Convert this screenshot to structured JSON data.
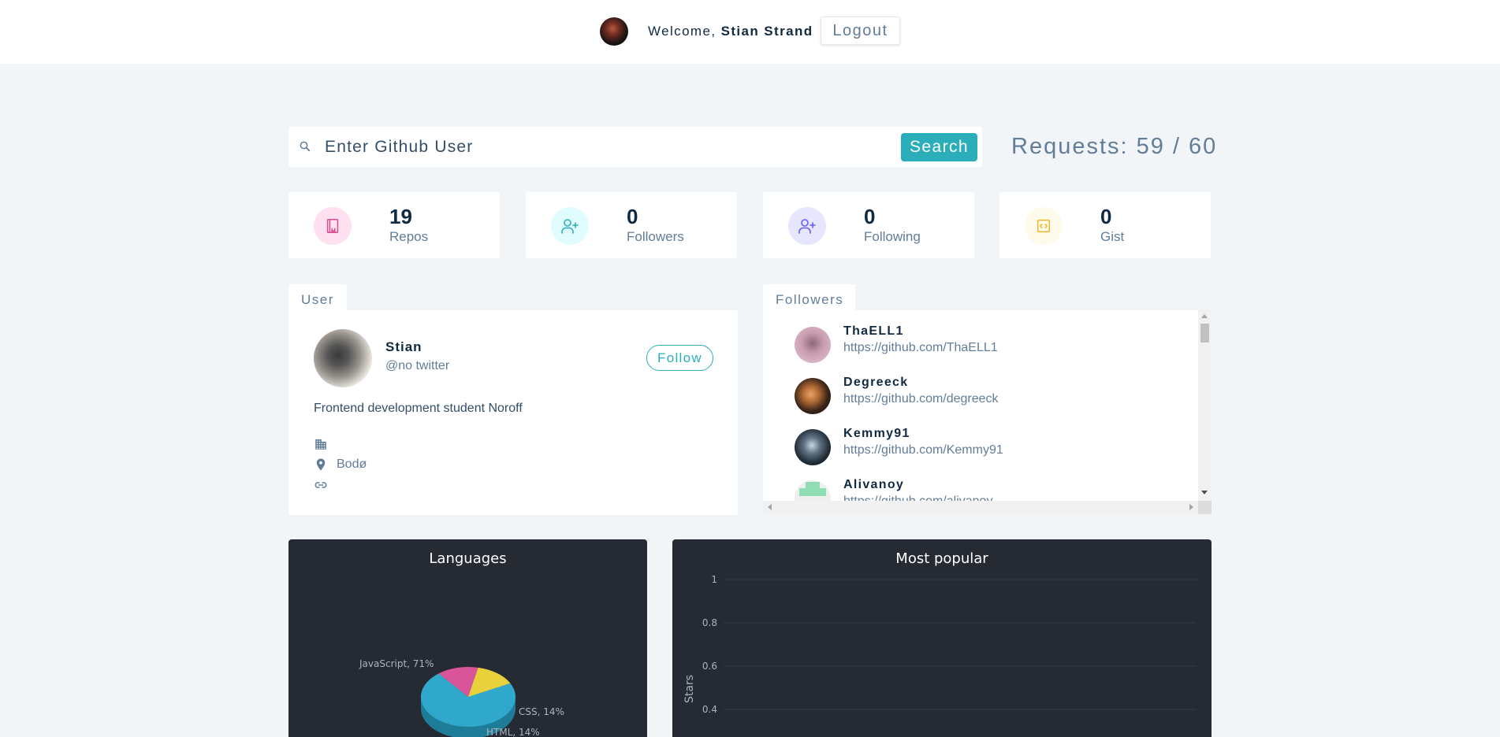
{
  "nav": {
    "welcome_prefix": "Welcome,",
    "user_name": "Stian Strand",
    "logout_label": "Logout"
  },
  "search": {
    "placeholder": "Enter Github User",
    "button_label": "Search",
    "requests_label": "Requests: 59 / 60"
  },
  "stats": [
    {
      "value": "19",
      "label": "Repos",
      "icon": "book-icon",
      "color": "#da4a91",
      "bg": "#ffe0f0"
    },
    {
      "value": "0",
      "label": "Followers",
      "icon": "add-user-icon",
      "color": "#2caeba",
      "bg": "#e0fcff"
    },
    {
      "value": "0",
      "label": "Following",
      "icon": "add-user-icon",
      "color": "#645cff",
      "bg": "#e6e6ff"
    },
    {
      "value": "0",
      "label": "Gist",
      "icon": "code-icon",
      "color": "#f0b429",
      "bg": "#fffbea"
    }
  ],
  "user": {
    "tab_label": "User",
    "name": "Stian",
    "twitter": "@no twitter",
    "follow_label": "Follow",
    "bio": "Frontend development student Noroff",
    "company": "",
    "location": "Bodø",
    "blog": ""
  },
  "followers": {
    "tab_label": "Followers",
    "items": [
      {
        "name": "ThaELL1",
        "url": "https://github.com/ThaELL1"
      },
      {
        "name": "Degreeck",
        "url": "https://github.com/degreeck"
      },
      {
        "name": "Kemmy91",
        "url": "https://github.com/Kemmy91"
      },
      {
        "name": "Alivanoy",
        "url": "https://github.com/alivanoy"
      }
    ]
  },
  "chart_data": [
    {
      "type": "pie",
      "title": "Languages",
      "categories": [
        "JavaScript",
        "CSS",
        "HTML"
      ],
      "values": [
        71,
        14,
        14
      ],
      "labels": [
        "JavaScript, 71%",
        "CSS, 14%",
        "HTML, 14%"
      ],
      "colors": [
        "#2fa8cc",
        "#d9559a",
        "#e8d13b"
      ]
    },
    {
      "type": "bar",
      "title": "Most popular",
      "ylabel": "Stars",
      "ylim": [
        0,
        1
      ],
      "yticks": [
        "1",
        "0.8",
        "0.6",
        "0.4"
      ],
      "categories": [],
      "values": []
    }
  ]
}
